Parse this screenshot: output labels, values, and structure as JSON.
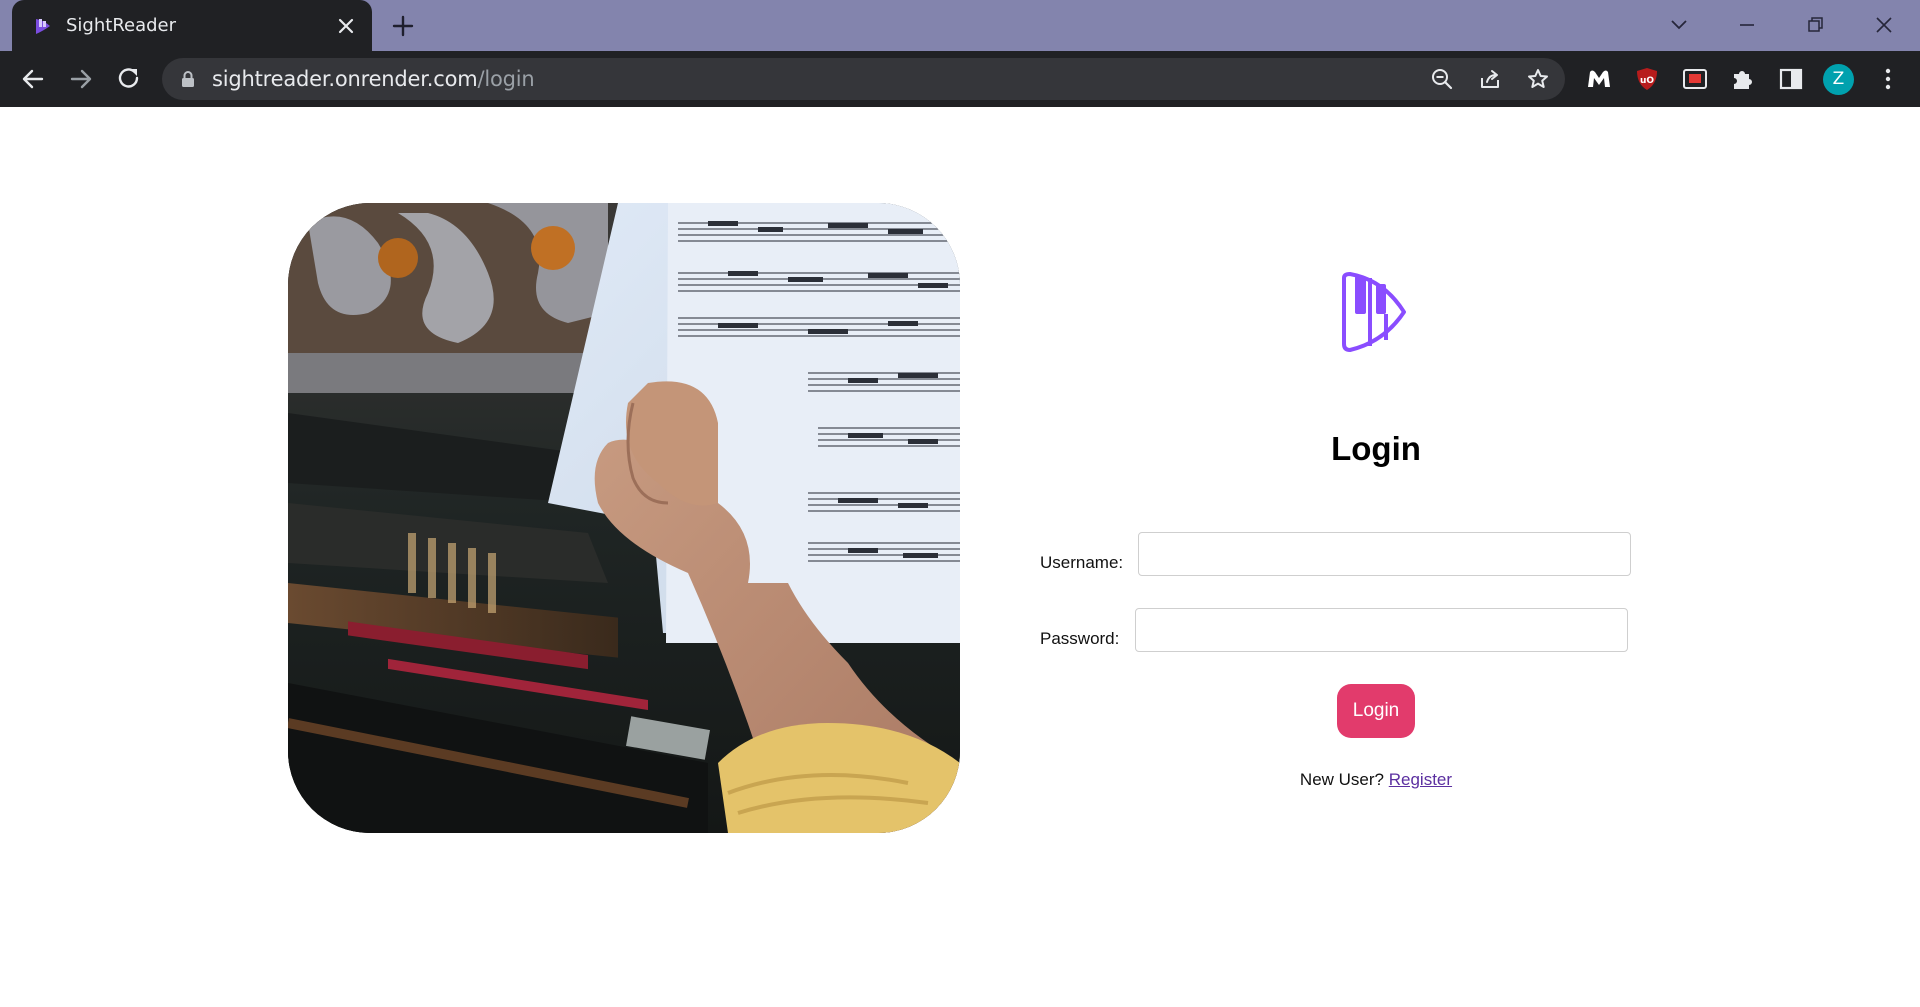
{
  "browser": {
    "tab": {
      "title": "SightReader"
    },
    "address": {
      "host": "sightreader.onrender.com",
      "path": "/login"
    },
    "profile_initial": "Z",
    "icons": {
      "tab_favicon": "sightreader-favicon-icon",
      "tab_close": "close-icon",
      "new_tab": "plus-icon",
      "tab_search": "chevron-down-icon",
      "minimize": "minimize-icon",
      "restore": "restore-icon",
      "close_window": "close-icon",
      "back": "arrow-left-icon",
      "forward": "arrow-right-icon",
      "reload": "reload-icon",
      "lock": "lock-icon",
      "zoom": "zoom-out-icon",
      "share": "share-icon",
      "bookmark": "star-icon",
      "extensions": [
        "malwarebytes-icon",
        "ublock-icon",
        "screen-recorder-icon",
        "puzzle-icon",
        "side-panel-icon"
      ],
      "menu": "kebab-menu-icon"
    },
    "colors": {
      "tabstrip": "#8384ad",
      "chrome": "#202124",
      "omnibox": "#35363a",
      "profile": "#00a1ae"
    }
  },
  "page": {
    "hero_image": "hand-turning-sheet-music-over-piano",
    "logo": "piano-keys-play-logo-icon",
    "title": "Login",
    "username": {
      "label": "Username:",
      "value": ""
    },
    "password": {
      "label": "Password:",
      "value": ""
    },
    "submit_label": "Login",
    "register_prompt": "New User?",
    "register_link": "Register",
    "colors": {
      "accent": "#e23b6c",
      "logo": "#8a4dff",
      "link": "#5b2fa0"
    }
  }
}
